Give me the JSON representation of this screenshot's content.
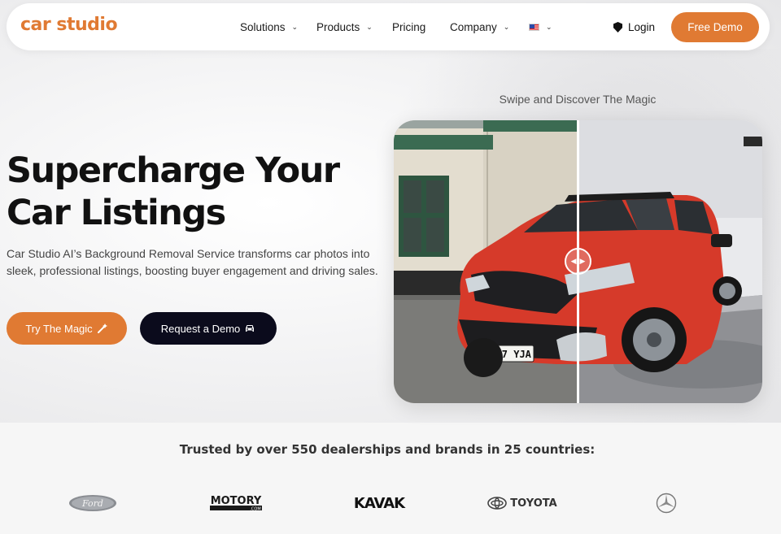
{
  "nav": {
    "logo": "car studio",
    "items": [
      {
        "label": "Solutions",
        "dropdown": true
      },
      {
        "label": "Products",
        "dropdown": true
      },
      {
        "label": "Pricing",
        "dropdown": false
      },
      {
        "label": "Company",
        "dropdown": true
      }
    ],
    "language_flag": "us-flag-icon",
    "login_label": "Login",
    "demo_label": "Free Demo"
  },
  "hero": {
    "title": "Supercharge Your Car Listings",
    "subtitle": "Car Studio AI’s Background Removal Service transforms car photos into sleek, professional listings, boosting buyer engagement and driving sales.",
    "primary_button": "Try The Magic",
    "secondary_button": "Request a Demo"
  },
  "compare": {
    "label": "Swipe and Discover The Magic",
    "plate": "HT17 YJA"
  },
  "trusted": {
    "text": "Trusted by over 550 dealerships and brands in 25 countries:",
    "brands": [
      "Ford",
      "MOTORY",
      ".COM",
      "KAVAK",
      "TOYOTA"
    ]
  },
  "colors": {
    "accent": "#e07a33",
    "dark_button": "#0b0b1c",
    "car_red": "#d63a2a"
  }
}
